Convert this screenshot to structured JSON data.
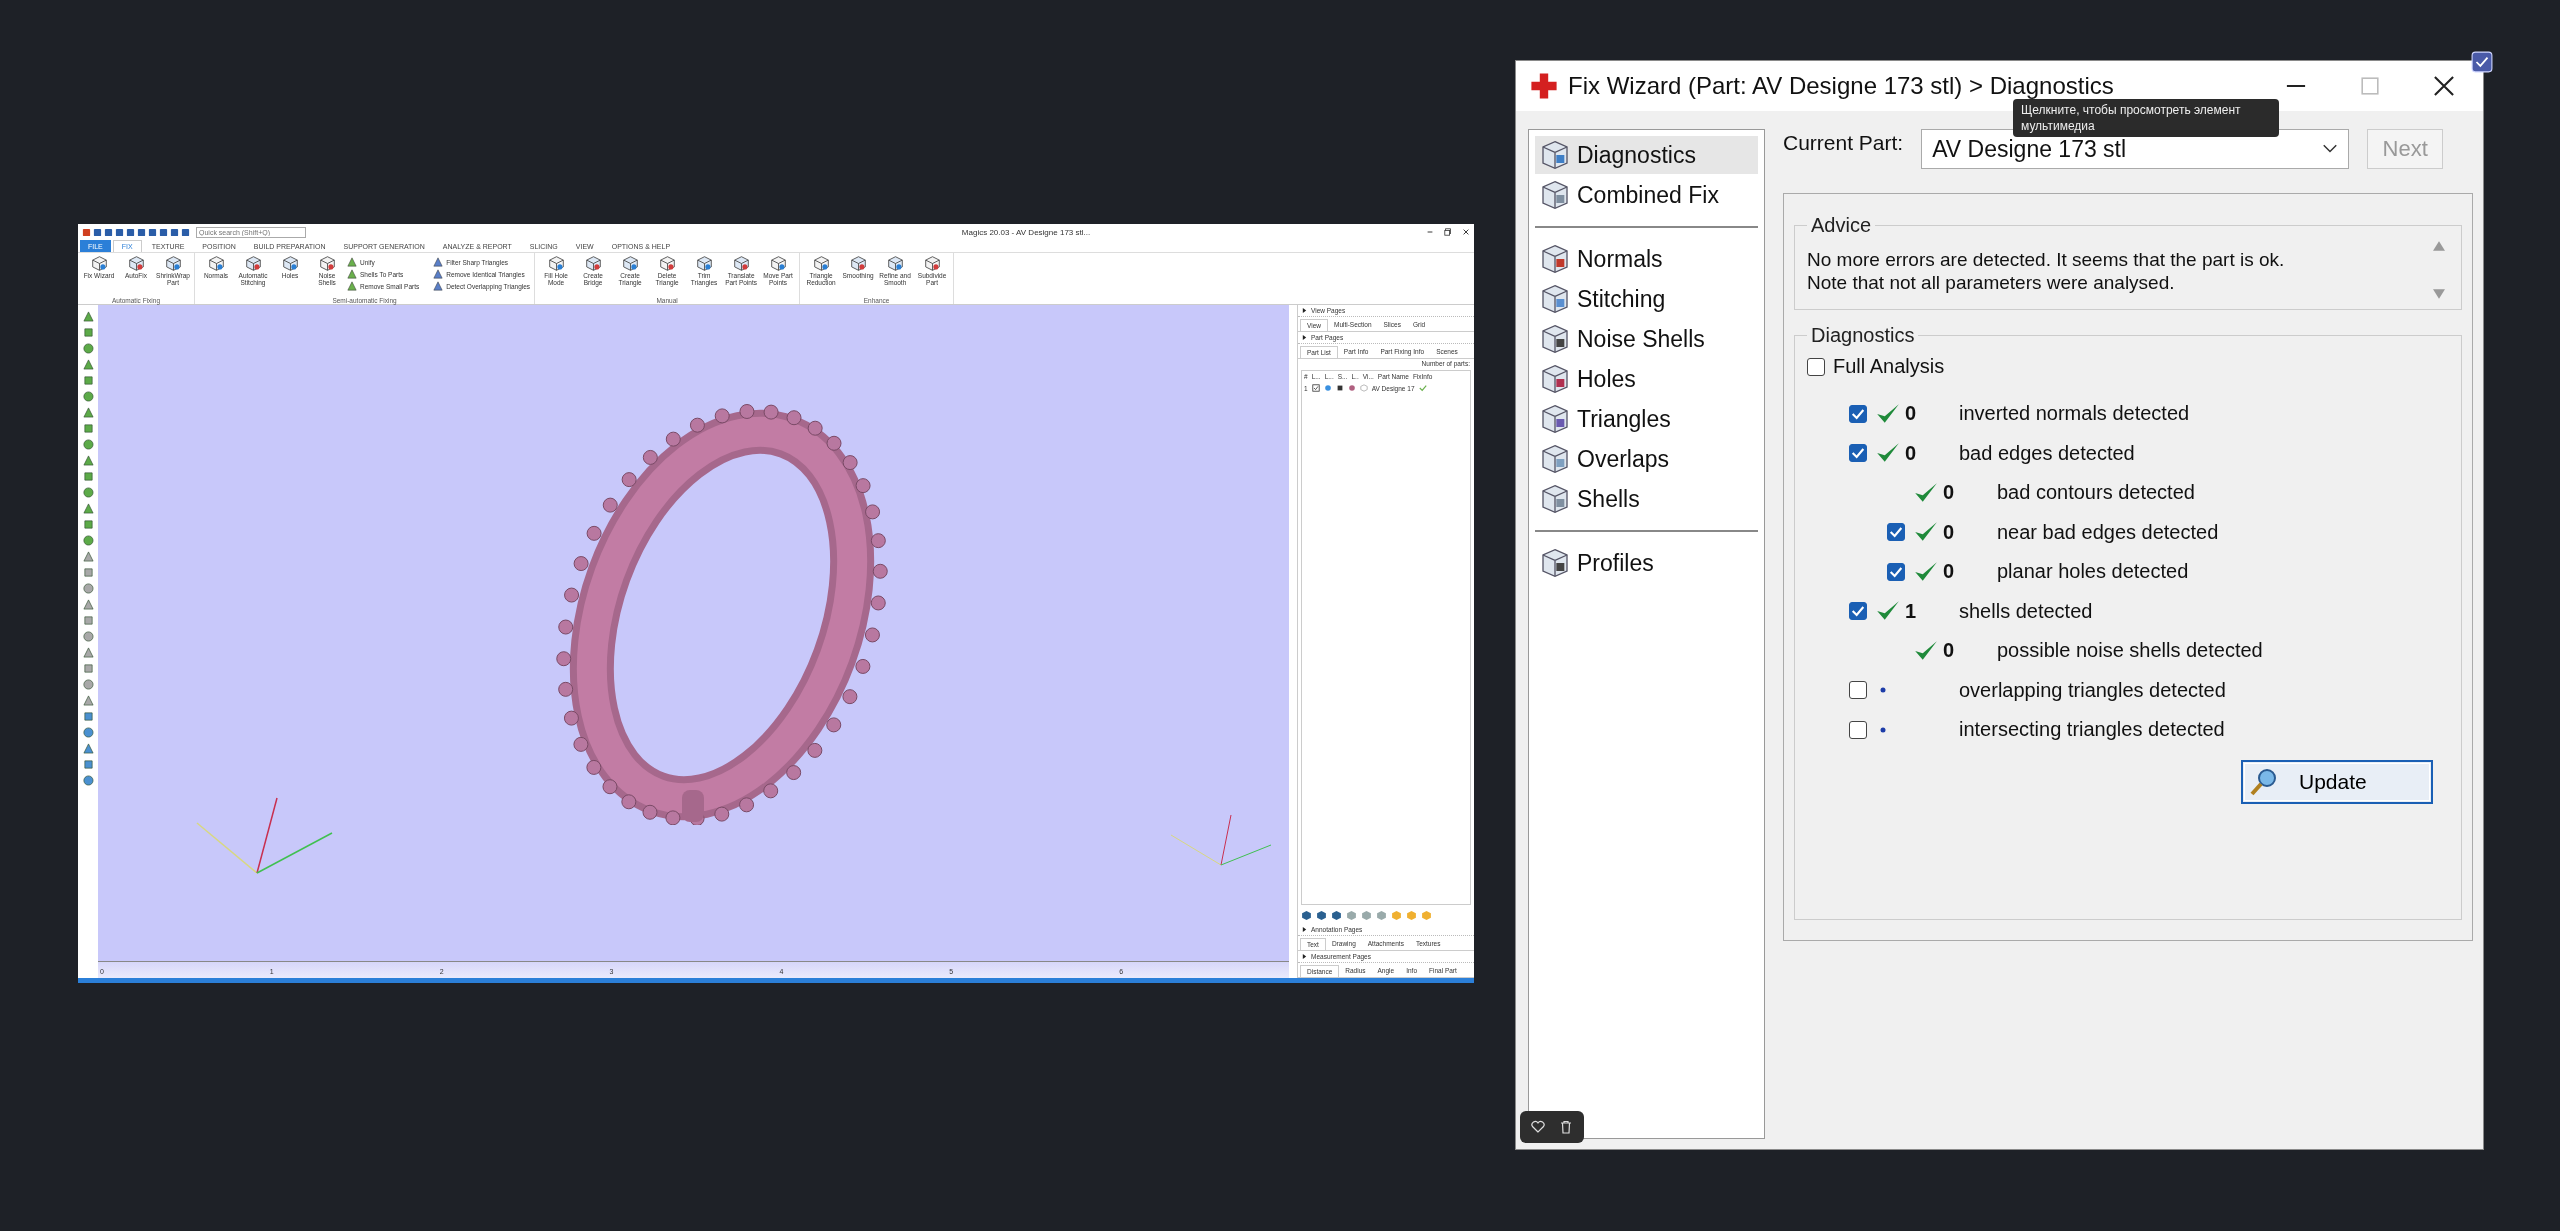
{
  "magics": {
    "title": "Magics 20.03 - AV Designe 173 stl...",
    "search": {
      "placeholder": "Quick search (Shift+Q)"
    },
    "tabs": [
      {
        "label": "FILE",
        "kind": "file",
        "selected": false
      },
      {
        "label": "FIX",
        "kind": "tab",
        "selected": true
      },
      {
        "label": "TEXTURE",
        "kind": "tab",
        "selected": false
      },
      {
        "label": "POSITION",
        "kind": "tab",
        "selected": false
      },
      {
        "label": "BUILD PREPARATION",
        "kind": "tab",
        "selected": false
      },
      {
        "label": "SUPPORT GENERATION",
        "kind": "tab",
        "selected": false
      },
      {
        "label": "ANALYZE & REPORT",
        "kind": "tab",
        "selected": false
      },
      {
        "label": "SLICING",
        "kind": "tab",
        "selected": false
      },
      {
        "label": "VIEW",
        "kind": "tab",
        "selected": false
      },
      {
        "label": "OPTIONS & HELP",
        "kind": "tab",
        "selected": false
      }
    ],
    "ribbon": [
      {
        "label": "Automatic Fixing",
        "buttons": [
          {
            "label": "Fix Wizard",
            "kind": "large"
          },
          {
            "label": "AutoFix",
            "kind": "large"
          },
          {
            "label": "ShrinkWrap Part",
            "kind": "large"
          }
        ]
      },
      {
        "label": "Semi-automatic Fixing",
        "buttons": [
          {
            "label": "Normals",
            "kind": "large"
          },
          {
            "label": "Automatic Stitching",
            "kind": "large"
          },
          {
            "label": "Holes",
            "kind": "large"
          },
          {
            "label": "Noise Shells",
            "kind": "large"
          },
          {
            "label": "Unify",
            "kind": "small"
          },
          {
            "label": "Shells To Parts",
            "kind": "small"
          },
          {
            "label": "Remove Small Parts",
            "kind": "small"
          },
          {
            "label": "Filter Sharp Triangles",
            "kind": "small"
          },
          {
            "label": "Remove Identical Triangles",
            "kind": "small"
          },
          {
            "label": "Detect Overlapping Triangles",
            "kind": "small"
          }
        ]
      },
      {
        "label": "Manual",
        "buttons": [
          {
            "label": "Fill Hole Mode",
            "kind": "large"
          },
          {
            "label": "Create Bridge",
            "kind": "large"
          },
          {
            "label": "Create Triangle",
            "kind": "large"
          },
          {
            "label": "Delete Triangle",
            "kind": "large"
          },
          {
            "label": "Trim Triangles",
            "kind": "large"
          },
          {
            "label": "Translate Part Points",
            "kind": "large"
          },
          {
            "label": "Move Part Points",
            "kind": "large"
          }
        ]
      },
      {
        "label": "Enhance",
        "buttons": [
          {
            "label": "Triangle Reduction",
            "kind": "large"
          },
          {
            "label": "Smoothing",
            "kind": "large"
          },
          {
            "label": "Refine and Smooth",
            "kind": "large"
          },
          {
            "label": "Subdivide Part",
            "kind": "large"
          }
        ]
      }
    ],
    "ruler": [
      "0",
      "1",
      "2",
      "3",
      "4",
      "5",
      "6"
    ],
    "panel": {
      "view_pages": {
        "title": "View Pages",
        "tabs": [
          {
            "label": "View",
            "selected": true
          },
          {
            "label": "Multi-Section",
            "selected": false
          },
          {
            "label": "Slices",
            "selected": false
          },
          {
            "label": "Grid",
            "selected": false
          }
        ]
      },
      "part_pages": {
        "title": "Part Pages",
        "tabs": [
          {
            "label": "Part List",
            "selected": true
          },
          {
            "label": "Part Info",
            "selected": false
          },
          {
            "label": "Part Fixing Info",
            "selected": false
          },
          {
            "label": "Scenes",
            "selected": false
          }
        ],
        "count_label": "Number of parts:"
      },
      "columns": [
        "#",
        "L...",
        "L...",
        "S...",
        "L..",
        "Vi...",
        "Part Name",
        "FixInfo"
      ],
      "rows": [
        {
          "index": "1",
          "name": "AV Designe 17",
          "fixed": true
        }
      ],
      "annotation_pages": {
        "title": "Annotation Pages",
        "tabs": [
          {
            "label": "Text",
            "selected": true
          },
          {
            "label": "Drawing",
            "selected": false
          },
          {
            "label": "Attachments",
            "selected": false
          },
          {
            "label": "Textures",
            "selected": false
          }
        ]
      },
      "measurement_pages": {
        "title": "Measurement Pages",
        "tabs": [
          {
            "label": "Distance",
            "selected": true
          },
          {
            "label": "Radius",
            "selected": false
          },
          {
            "label": "Angle",
            "selected": false
          },
          {
            "label": "Info",
            "selected": false
          },
          {
            "label": "Final Part",
            "selected": false
          }
        ]
      }
    }
  },
  "wizard": {
    "title": "Fix Wizard (Part: AV Designe 173 stl) > Diagnostics",
    "tooltip": "Щелкните, чтобы просмотреть элемент мультимедиа",
    "nav": [
      [
        {
          "label": "Diagnostics",
          "selected": true
        },
        {
          "label": "Combined Fix",
          "selected": false
        }
      ],
      [
        {
          "label": "Normals",
          "selected": false
        },
        {
          "label": "Stitching",
          "selected": false
        },
        {
          "label": "Noise Shells",
          "selected": false
        },
        {
          "label": "Holes",
          "selected": false
        },
        {
          "label": "Triangles",
          "selected": false
        },
        {
          "label": "Overlaps",
          "selected": false
        },
        {
          "label": "Shells",
          "selected": false
        }
      ],
      [
        {
          "label": "Profiles",
          "selected": false
        }
      ]
    ],
    "current_part": {
      "label": "Current Part:",
      "value": "AV Designe 173 stl"
    },
    "next_button": {
      "label": "Next",
      "disabled": true
    },
    "advice": {
      "title": "Advice",
      "text": "No more errors are detected. It seems that the part is ok.\nNote that not all parameters were analysed."
    },
    "diagnostics": {
      "title": "Diagnostics",
      "full_analysis": {
        "label": "Full Analysis",
        "checked": false
      },
      "rows": [
        {
          "kind": "check",
          "checked": true,
          "passed": true,
          "count": "0",
          "label": "inverted normals detected"
        },
        {
          "kind": "check",
          "checked": true,
          "passed": true,
          "count": "0",
          "label": "bad edges detected",
          "children": [
            {
              "kind": "info",
              "passed": true,
              "count": "0",
              "label": "bad contours detected"
            },
            {
              "kind": "check",
              "checked": true,
              "passed": true,
              "count": "0",
              "label": "near bad edges detected"
            },
            {
              "kind": "check",
              "checked": true,
              "passed": true,
              "count": "0",
              "label": "planar holes detected"
            }
          ]
        },
        {
          "kind": "check",
          "checked": true,
          "passed": true,
          "count": "1",
          "label": "shells detected",
          "children": [
            {
              "kind": "info",
              "passed": true,
              "count": "0",
              "label": "possible noise shells detected"
            }
          ]
        },
        {
          "kind": "check",
          "checked": false,
          "passed": false,
          "label": "overlapping triangles detected"
        },
        {
          "kind": "check",
          "checked": false,
          "passed": false,
          "label": "intersecting triangles detected"
        }
      ]
    },
    "update_button": {
      "label": "Update"
    }
  }
}
